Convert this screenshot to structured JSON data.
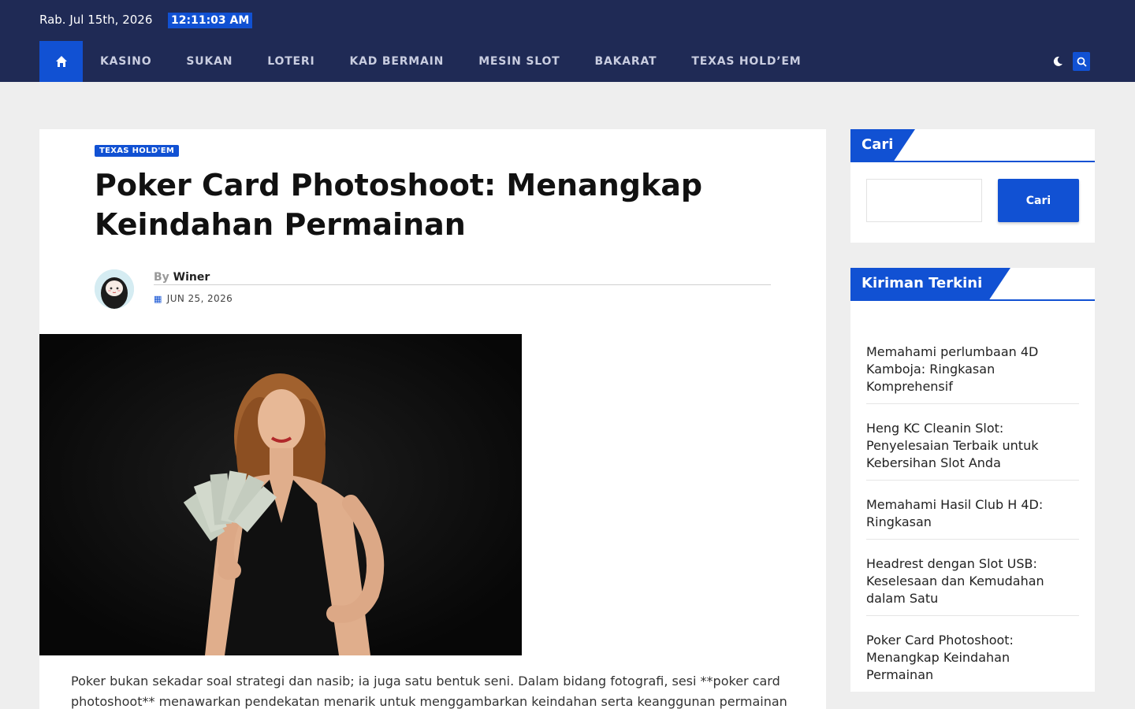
{
  "header": {
    "date": "Rab. Jul 15th, 2026",
    "time": "12:11:03 AM"
  },
  "nav": {
    "home_icon": "home-icon",
    "items": [
      "KASINO",
      "SUKAN",
      "LOTERI",
      "KAD BERMAIN",
      "MESIN SLOT",
      "BAKARAT",
      "TEXAS HOLD’EM"
    ],
    "theme_icon": "moon-icon",
    "search_icon": "search-icon"
  },
  "article": {
    "category": "TEXAS HOLD'EM",
    "title": "Poker Card Photoshoot: Menangkap Keindahan Permainan",
    "by_label": "By",
    "author": "Winer",
    "date": "JUN 25, 2026",
    "text": "Poker bukan sekadar soal strategi dan nasib; ia juga satu bentuk seni. Dalam bidang fotografi, sesi **poker card photoshoot** menawarkan pendekatan menarik untuk menggambarkan keindahan serta keanggunan permainan"
  },
  "sidebar": {
    "search": {
      "title": "Cari",
      "button_label": "Cari",
      "input_value": ""
    },
    "recent": {
      "title": "Kiriman Terkini",
      "items": [
        "Memahami perlumbaan 4D Kamboja: Ringkasan Komprehensif",
        "Heng KC Cleanin Slot: Penyelesaian Terbaik untuk Kebersihan Slot Anda",
        "Memahami Hasil Club H 4D: Ringkasan",
        "Headrest dengan Slot USB: Keselesaan dan Kemudahan dalam Satu",
        "Poker Card Photoshoot: Menangkap Keindahan Permainan"
      ]
    }
  },
  "colors": {
    "header_bg": "#1f2a55",
    "accent": "#1151d3",
    "page_bg": "#eeeeee"
  }
}
